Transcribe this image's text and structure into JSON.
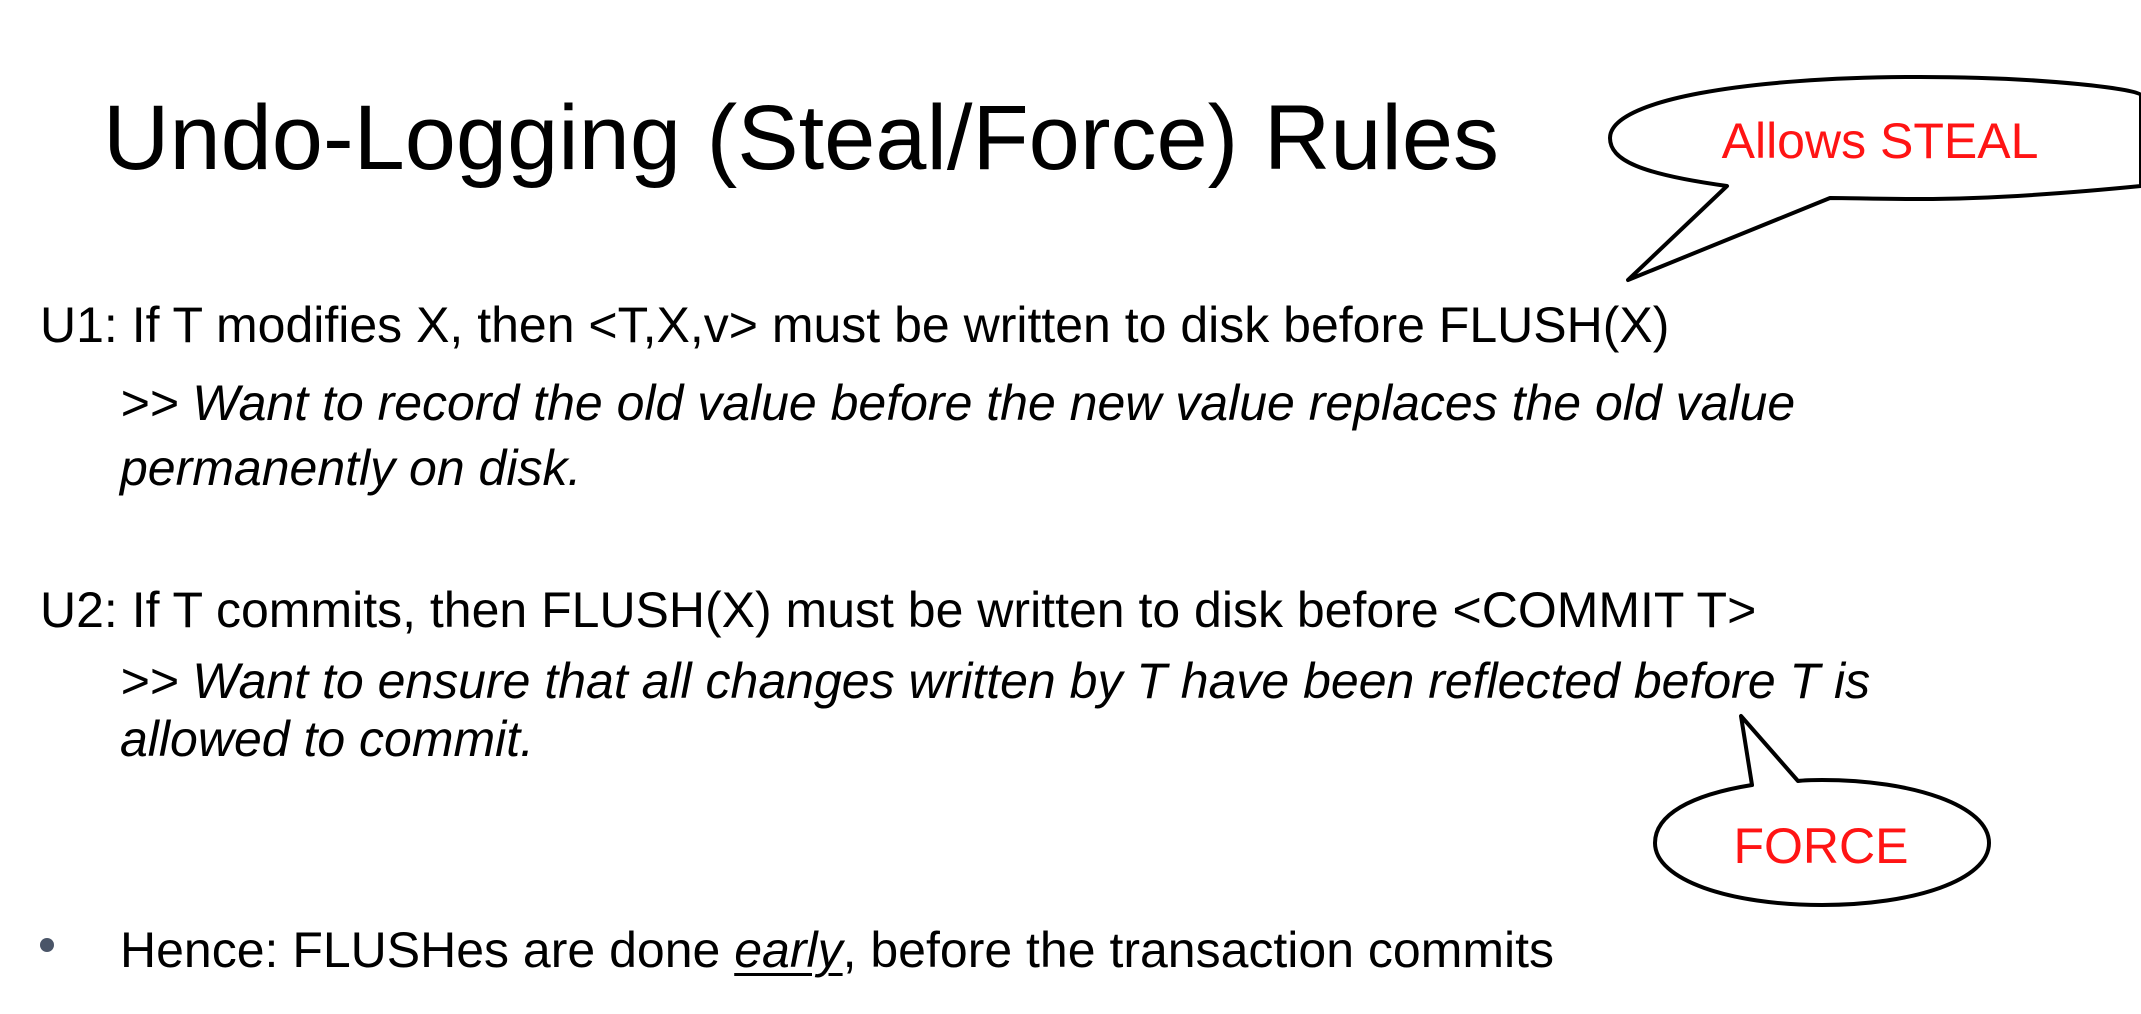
{
  "slide": {
    "title": "Undo-Logging (Steal/Force) Rules",
    "rules": [
      {
        "statement": "U1: If T modifies X, then <T,X,v> must be written to disk before FLUSH(X)",
        "note_line1": ">> Want to record the old value before the new value replaces the old value",
        "note_line2": "permanently on disk."
      },
      {
        "statement": "U2: If T commits, then FLUSH(X) must be written to disk before <COMMIT T>",
        "note_line1": ">> Want to ensure that all changes written by T have been reflected before T is",
        "note_line2": "allowed to commit."
      }
    ],
    "bullet": {
      "prefix": "Hence: FLUSHes are done ",
      "emphasis": "early",
      "suffix": ", before the transaction commits"
    },
    "callouts": {
      "steal": "Allows STEAL",
      "force": "FORCE"
    }
  },
  "colors": {
    "callout_text": "#ff1414",
    "bullet_dot": "#4a5568"
  }
}
